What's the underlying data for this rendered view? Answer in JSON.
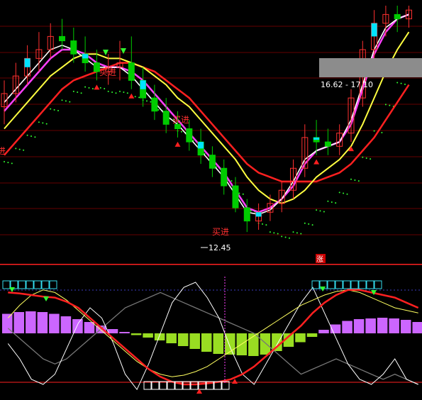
{
  "chart_data": {
    "type": "candlestick",
    "subtype": "stock chart with moving averages and indicator subpanel",
    "colors": {
      "up": "#00e5ff",
      "down": "#00cc00",
      "up_border": "#ff3030",
      "ma_short": "#ffffff",
      "ma_mid": "#ff40ff",
      "ma_long": "#ffff40",
      "ma_slow": "#ff2020",
      "dots": "#30ff30",
      "bar_pos": "#cc66ff",
      "bar_neg": "#99dd22",
      "grid": "#880000"
    },
    "price_axis": {
      "min": 12.0,
      "max": 17.6
    },
    "annotations": {
      "low_label": "12.45",
      "buy_signal": "买进",
      "range_label": "16.62 - 17.10",
      "rise_badge": "涨",
      "edge_label": "进"
    },
    "buy_signals_at": [
      8,
      15,
      27,
      11,
      30
    ],
    "candles": [
      {
        "o": 15.3,
        "h": 15.9,
        "l": 14.9,
        "c": 15.6
      },
      {
        "o": 15.6,
        "h": 16.3,
        "l": 15.4,
        "c": 16.0
      },
      {
        "o": 16.0,
        "h": 16.7,
        "l": 15.8,
        "c": 16.4
      },
      {
        "o": 16.4,
        "h": 17.0,
        "l": 16.1,
        "c": 16.6
      },
      {
        "o": 16.6,
        "h": 17.2,
        "l": 16.4,
        "c": 16.9
      },
      {
        "o": 16.9,
        "h": 17.3,
        "l": 16.6,
        "c": 16.8
      },
      {
        "o": 16.8,
        "h": 17.1,
        "l": 16.3,
        "c": 16.5
      },
      {
        "o": 16.5,
        "h": 16.9,
        "l": 16.1,
        "c": 16.3
      },
      {
        "o": 16.3,
        "h": 16.6,
        "l": 15.9,
        "c": 16.1
      },
      {
        "o": 16.1,
        "h": 16.5,
        "l": 15.8,
        "c": 16.2
      },
      {
        "o": 16.2,
        "h": 16.8,
        "l": 15.9,
        "c": 16.3
      },
      {
        "o": 16.3,
        "h": 16.9,
        "l": 15.7,
        "c": 15.9
      },
      {
        "o": 15.9,
        "h": 16.2,
        "l": 15.3,
        "c": 15.5
      },
      {
        "o": 15.5,
        "h": 15.8,
        "l": 15.0,
        "c": 15.2
      },
      {
        "o": 15.2,
        "h": 15.5,
        "l": 14.7,
        "c": 14.9
      },
      {
        "o": 14.9,
        "h": 15.2,
        "l": 14.6,
        "c": 14.8
      },
      {
        "o": 14.8,
        "h": 15.0,
        "l": 14.3,
        "c": 14.5
      },
      {
        "o": 14.5,
        "h": 14.8,
        "l": 14.0,
        "c": 14.2
      },
      {
        "o": 14.2,
        "h": 14.4,
        "l": 13.7,
        "c": 13.9
      },
      {
        "o": 13.9,
        "h": 14.1,
        "l": 13.3,
        "c": 13.5
      },
      {
        "o": 13.5,
        "h": 13.7,
        "l": 12.9,
        "c": 13.0
      },
      {
        "o": 13.0,
        "h": 13.2,
        "l": 12.45,
        "c": 12.7
      },
      {
        "o": 12.7,
        "h": 13.1,
        "l": 12.5,
        "c": 12.9
      },
      {
        "o": 12.9,
        "h": 13.3,
        "l": 12.7,
        "c": 13.1
      },
      {
        "o": 13.1,
        "h": 13.6,
        "l": 12.9,
        "c": 13.4
      },
      {
        "o": 13.4,
        "h": 14.1,
        "l": 13.2,
        "c": 13.9
      },
      {
        "o": 13.9,
        "h": 14.9,
        "l": 13.7,
        "c": 14.6
      },
      {
        "o": 14.6,
        "h": 15.0,
        "l": 14.2,
        "c": 14.5
      },
      {
        "o": 14.5,
        "h": 14.8,
        "l": 14.2,
        "c": 14.4
      },
      {
        "o": 14.4,
        "h": 14.9,
        "l": 14.2,
        "c": 14.7
      },
      {
        "o": 14.7,
        "h": 15.7,
        "l": 14.5,
        "c": 15.5
      },
      {
        "o": 15.5,
        "h": 16.8,
        "l": 15.3,
        "c": 16.6
      },
      {
        "o": 16.6,
        "h": 17.5,
        "l": 16.4,
        "c": 17.2
      },
      {
        "o": 17.2,
        "h": 17.6,
        "l": 16.9,
        "c": 17.4
      },
      {
        "o": 17.4,
        "h": 17.6,
        "l": 17.0,
        "c": 17.3
      },
      {
        "o": 17.3,
        "h": 17.6,
        "l": 17.1,
        "c": 17.5
      }
    ],
    "ma_short": [
      15.4,
      15.7,
      16.0,
      16.3,
      16.6,
      16.7,
      16.6,
      16.4,
      16.2,
      16.2,
      16.2,
      16.0,
      15.7,
      15.4,
      15.1,
      14.9,
      14.6,
      14.3,
      14.0,
      13.7,
      13.3,
      12.9,
      12.85,
      12.95,
      13.2,
      13.6,
      14.1,
      14.3,
      14.4,
      14.5,
      15.0,
      15.8,
      16.6,
      17.1,
      17.3,
      17.4
    ],
    "ma_mid": [
      15.2,
      15.5,
      15.8,
      16.1,
      16.4,
      16.6,
      16.6,
      16.5,
      16.3,
      16.2,
      16.2,
      16.1,
      15.9,
      15.6,
      15.3,
      15.0,
      14.7,
      14.4,
      14.1,
      13.8,
      13.4,
      13.0,
      12.9,
      13.0,
      13.2,
      13.5,
      14.0,
      14.3,
      14.4,
      14.5,
      14.9,
      15.7,
      16.5,
      17.0,
      17.3,
      17.4
    ],
    "ma_long": [
      14.8,
      15.1,
      15.4,
      15.7,
      16.0,
      16.2,
      16.4,
      16.5,
      16.5,
      16.4,
      16.4,
      16.3,
      16.2,
      16.0,
      15.8,
      15.5,
      15.3,
      15.0,
      14.7,
      14.4,
      14.1,
      13.7,
      13.4,
      13.2,
      13.1,
      13.2,
      13.4,
      13.7,
      13.9,
      14.1,
      14.4,
      14.9,
      15.5,
      16.1,
      16.6,
      17.0
    ],
    "ma_slow": [
      14.2,
      14.5,
      14.8,
      15.1,
      15.4,
      15.7,
      15.9,
      16.0,
      16.1,
      16.2,
      16.3,
      16.3,
      16.2,
      16.1,
      15.9,
      15.7,
      15.5,
      15.2,
      14.9,
      14.6,
      14.3,
      14.0,
      13.8,
      13.7,
      13.6,
      13.6,
      13.6,
      13.6,
      13.7,
      13.8,
      14.0,
      14.3,
      14.6,
      15.0,
      15.4,
      15.8
    ],
    "sub_bars": [
      0.55,
      0.6,
      0.62,
      0.6,
      0.55,
      0.48,
      0.4,
      0.32,
      0.22,
      0.12,
      0.04,
      -0.05,
      -0.12,
      -0.2,
      -0.28,
      -0.36,
      -0.44,
      -0.52,
      -0.58,
      -0.6,
      -0.62,
      -0.64,
      -0.6,
      -0.5,
      -0.38,
      -0.25,
      -0.1,
      0.1,
      0.25,
      0.35,
      0.4,
      0.42,
      0.44,
      0.42,
      0.38,
      0.32
    ],
    "sub_red": [
      0.8,
      0.78,
      0.75,
      0.72,
      0.7,
      0.62,
      0.5,
      0.3,
      0.1,
      -0.1,
      -0.3,
      -0.5,
      -0.7,
      -0.85,
      -0.95,
      -1.0,
      -1.0,
      -0.98,
      -0.95,
      -0.9,
      -0.8,
      -0.65,
      -0.45,
      -0.25,
      -0.05,
      0.15,
      0.4,
      0.6,
      0.75,
      0.85,
      0.85,
      0.8,
      0.75,
      0.7,
      0.6,
      0.5
    ],
    "sub_yellow": [
      0.3,
      0.55,
      0.75,
      0.85,
      0.8,
      0.65,
      0.45,
      0.25,
      0.05,
      -0.15,
      -0.35,
      -0.55,
      -0.7,
      -0.8,
      -0.85,
      -0.82,
      -0.75,
      -0.65,
      -0.5,
      -0.35,
      -0.2,
      -0.05,
      0.1,
      0.25,
      0.4,
      0.55,
      0.65,
      0.75,
      0.82,
      0.85,
      0.8,
      0.7,
      0.6,
      0.5,
      0.45,
      0.4
    ],
    "sub_white": [
      -0.2,
      -0.5,
      -0.9,
      -1.0,
      -0.8,
      -0.3,
      0.2,
      0.5,
      0.3,
      -0.2,
      -0.8,
      -1.1,
      -0.6,
      0.0,
      0.6,
      0.9,
      1.0,
      0.7,
      0.3,
      -0.3,
      -0.8,
      -1.0,
      -0.6,
      -0.2,
      0.2,
      0.6,
      0.9,
      0.4,
      -0.1,
      -0.6,
      -0.9,
      -1.0,
      -0.8,
      -0.5,
      -0.9,
      -1.0
    ],
    "sub_grey": [
      0.1,
      -0.1,
      -0.3,
      -0.5,
      -0.6,
      -0.5,
      -0.3,
      -0.1,
      0.1,
      0.3,
      0.5,
      0.6,
      0.7,
      0.8,
      0.7,
      0.6,
      0.5,
      0.4,
      0.3,
      0.2,
      0.1,
      0.0,
      -0.2,
      -0.4,
      -0.6,
      -0.8,
      -0.7,
      -0.6,
      -0.5,
      -0.6,
      -0.7,
      -0.8,
      -0.9,
      -0.8,
      -0.9,
      -1.0
    ]
  }
}
